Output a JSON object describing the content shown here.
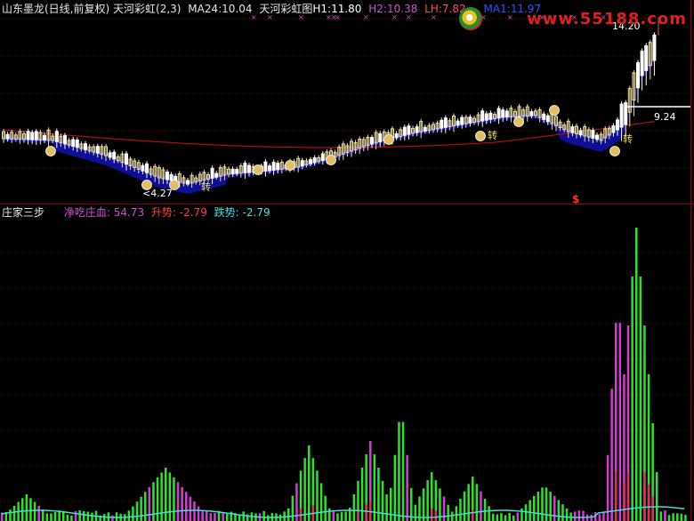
{
  "upper_header": {
    "title": "山东墨龙(日线,前复权)",
    "indicator": "天河彩虹(2,3)",
    "ma24_label": "MA24:",
    "ma24_value": "10.04",
    "chart_name": "天河彩虹图",
    "h1_label": "H1:",
    "h1_value": "11.80",
    "h2_label": "H2:",
    "h2_value": "10.38",
    "lh_label": "LH:",
    "lh_value": "7.82",
    "ma1_label": "MA1:",
    "ma1_value": "11.97"
  },
  "lower_header": {
    "title": "庄家三步",
    "f1_label": "净吃庄血:",
    "f1_value": "54.73",
    "f2_label": "升势:",
    "f2_value": "-2.79",
    "f3_label": "跌势:",
    "f3_value": "-2.79"
  },
  "watermark": "www.55188.com",
  "colors": {
    "background": "#000000",
    "grid": "#8b0000",
    "up_candle": "#f0e0a0",
    "down_candle": "#ffffff",
    "ribbon": "#1010b0",
    "ma24": "#b01010",
    "h1": "#ffffff",
    "h2": "#d050d0",
    "lh": "#ff5050",
    "ma1": "#3050ff",
    "green_bar": "#30e030",
    "magenta_bar": "#d040d0",
    "red_bar": "#e03060",
    "cyan_line": "#40e0e0",
    "f1": "#d050d0",
    "f2": "#ff4040",
    "f3": "#40e0e0"
  },
  "chart_data": [
    {
      "type": "candlestick",
      "title": "山东墨龙(日线,前复权) 天河彩虹(2,3)",
      "annotations": [
        {
          "text": "14.20",
          "kind": "price-high"
        },
        {
          "text": "4.27",
          "kind": "price-low"
        },
        {
          "text": "9.24",
          "kind": "price-level"
        },
        {
          "text": "转",
          "kind": "signal"
        },
        {
          "text": "转",
          "kind": "signal"
        },
        {
          "text": "转",
          "kind": "signal"
        },
        {
          "text": "$",
          "kind": "signal"
        }
      ],
      "grid": true
    },
    {
      "type": "bar",
      "title": "庄家三步",
      "series": [
        {
          "name": "净吃庄血",
          "value": 54.73
        },
        {
          "name": "升势",
          "value": -2.79
        },
        {
          "name": "跌势",
          "value": -2.79
        }
      ],
      "grid": true
    }
  ]
}
